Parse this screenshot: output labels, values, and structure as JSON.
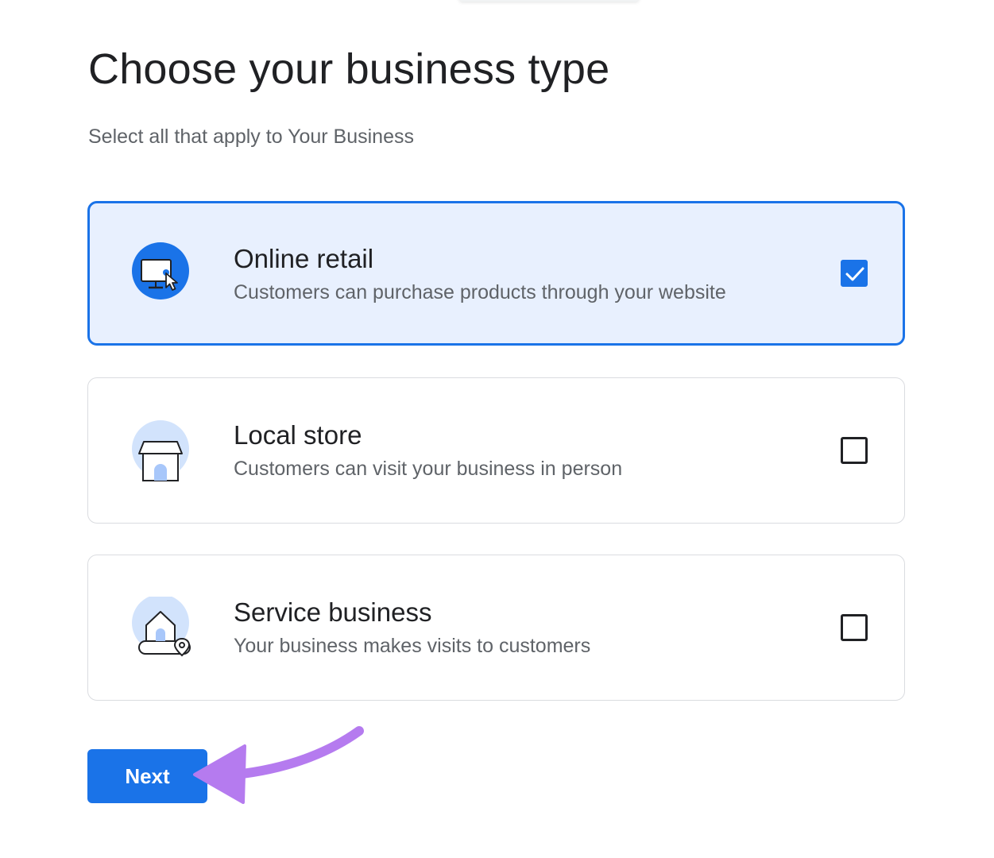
{
  "page": {
    "title": "Choose your business type",
    "subtitle": "Select all that apply to Your Business"
  },
  "options": [
    {
      "title": "Online retail",
      "description": "Customers can purchase products through your website",
      "icon": "monitor-cursor-icon",
      "checked": true
    },
    {
      "title": "Local store",
      "description": "Customers can visit your business in person",
      "icon": "storefront-icon",
      "checked": false
    },
    {
      "title": "Service business",
      "description": "Your business makes visits to customers",
      "icon": "house-location-icon",
      "checked": false
    }
  ],
  "actions": {
    "next_label": "Next"
  },
  "colors": {
    "accent": "#1a73e8",
    "selected_background": "#e8f0fe",
    "annotation_arrow": "#b57bef"
  }
}
